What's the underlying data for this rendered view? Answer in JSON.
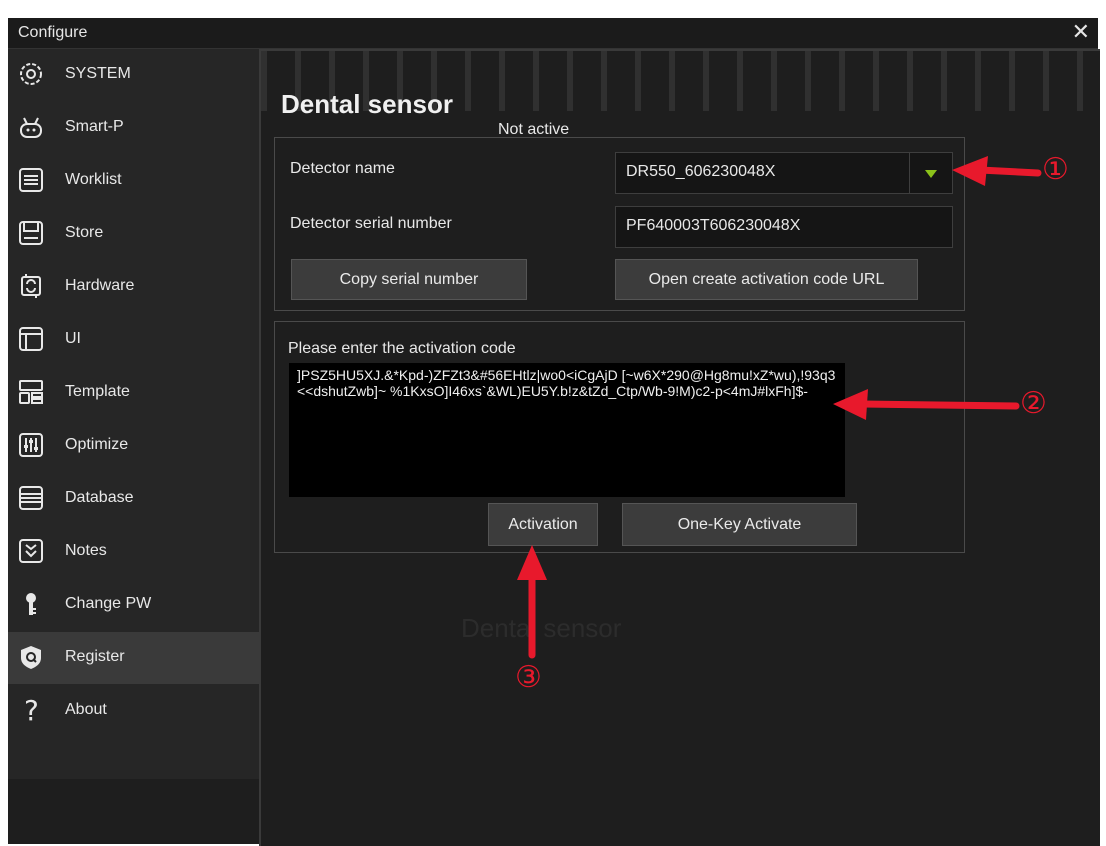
{
  "window": {
    "title": "Configure",
    "close_glyph": "✕"
  },
  "sidebar": {
    "items": [
      {
        "label": "SYSTEM",
        "icon": "system-icon"
      },
      {
        "label": "Smart-P",
        "icon": "robot-icon"
      },
      {
        "label": "Worklist",
        "icon": "worklist-icon"
      },
      {
        "label": "Store",
        "icon": "save-icon"
      },
      {
        "label": "Hardware",
        "icon": "hardware-icon"
      },
      {
        "label": "UI",
        "icon": "ui-layout-icon"
      },
      {
        "label": "Template",
        "icon": "template-icon"
      },
      {
        "label": "Optimize",
        "icon": "sliders-icon"
      },
      {
        "label": "Database",
        "icon": "database-icon"
      },
      {
        "label": "Notes",
        "icon": "notes-icon"
      },
      {
        "label": "Change PW",
        "icon": "key-icon"
      },
      {
        "label": "Register",
        "icon": "register-icon",
        "active": true
      },
      {
        "label": "About",
        "icon": "question-icon"
      }
    ]
  },
  "main": {
    "title": "Dental sensor",
    "status": "Not active",
    "detector": {
      "name_label": "Detector name",
      "name_value": "DR550_606230048X",
      "serial_label": "Detector serial number",
      "serial_value": "PF640003T606230048X",
      "copy_button": "Copy serial number",
      "open_url_button": "Open create activation code URL"
    },
    "activation": {
      "prompt": "Please enter the activation code",
      "code": "]PSZ5HU5XJ.&*Kpd-)ZFZt3&#56EHtlz|wo0<iCgAjD [~w6X*290@Hg8mu!xZ*wu),!93q3<<dshutZwb]~ %1KxsO]I46xs`&WL)EU5Y.b!z&tZd_Ctp/Wb-9!M)c2-p<4mJ#lxFh]$-",
      "activation_button": "Activation",
      "one_key_button": "One-Key Activate"
    },
    "ghost_text": "Dental sensor"
  },
  "annotations": {
    "one": "①",
    "two": "②",
    "three": "③",
    "color": "#e8192c"
  },
  "colors": {
    "accent_arrow": "#8bc21a",
    "background": "#1e1e1e",
    "sidebar": "#262626"
  }
}
